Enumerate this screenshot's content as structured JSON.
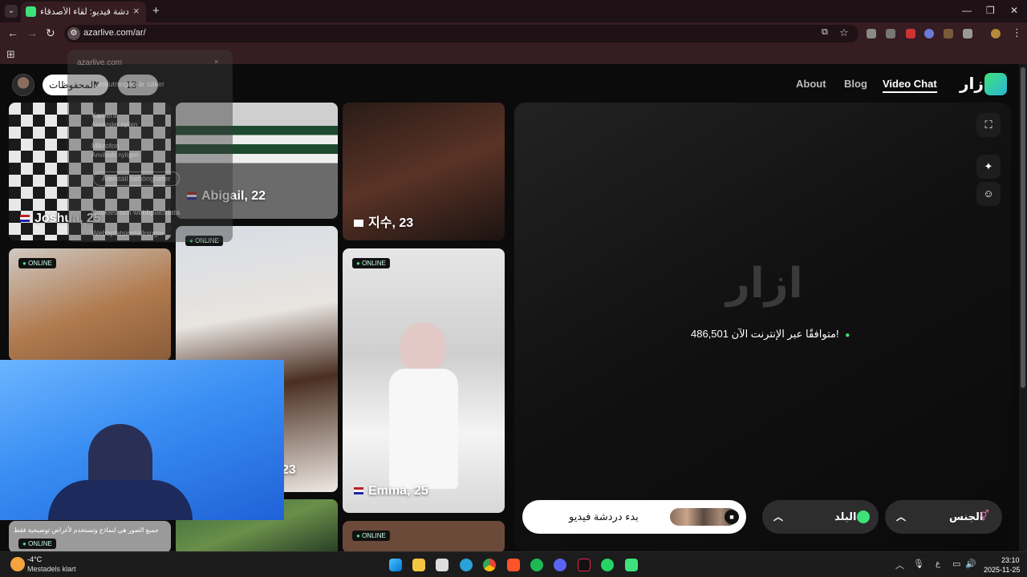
{
  "browser": {
    "tab_title": "أزار دردشة فيديو: لقاء الأصدقاء",
    "url": "azarlive.com/ar/"
  },
  "site_info_popup": {
    "domain": "azarlive.com",
    "items": [
      "Anslutningen är säker",
      "Kamera",
      "Använder nyllen",
      "Mikrofon",
      "Används nyligen",
      "Återställ behörigheter",
      "Cookies och webbplatsdata",
      "Webbplatsinställningar"
    ]
  },
  "header": {
    "nav": [
      "About",
      "Blog",
      "Video Chat"
    ],
    "brand": "ازار",
    "saved_label": "المحفوظات",
    "saved_count": "13"
  },
  "cards": [
    {
      "name": "Joshua, 25",
      "flag": "us"
    },
    {
      "name": "Abigail, 22",
      "flag": "us"
    },
    {
      "name": "지수, 23",
      "flag": "kr"
    },
    {
      "name": "Emma, 25",
      "flag": "us"
    },
    {
      "name": "23"
    }
  ],
  "badges": {
    "online": "ONLINE"
  },
  "video_panel": {
    "watermark": "ازار",
    "online_count": "486,501 متوافقًا عبر الإنترنت الآن!",
    "start_button": "بدء دردشة فيديو",
    "country_filter": "البلد",
    "gender_filter": "الجنس"
  },
  "footer_note": "جميع الصور هي لنماذج وتستخدم لأغراض توضيحية فقط",
  "taskbar": {
    "weather_temp": "-4°C",
    "weather_desc": "Mestadels klart",
    "lang": "ع",
    "time": "23:10",
    "date": "2025-11-25"
  },
  "colors": {
    "accent": "#3ee27a",
    "chrome": "#351d22",
    "tabstrip": "#1f1216"
  }
}
